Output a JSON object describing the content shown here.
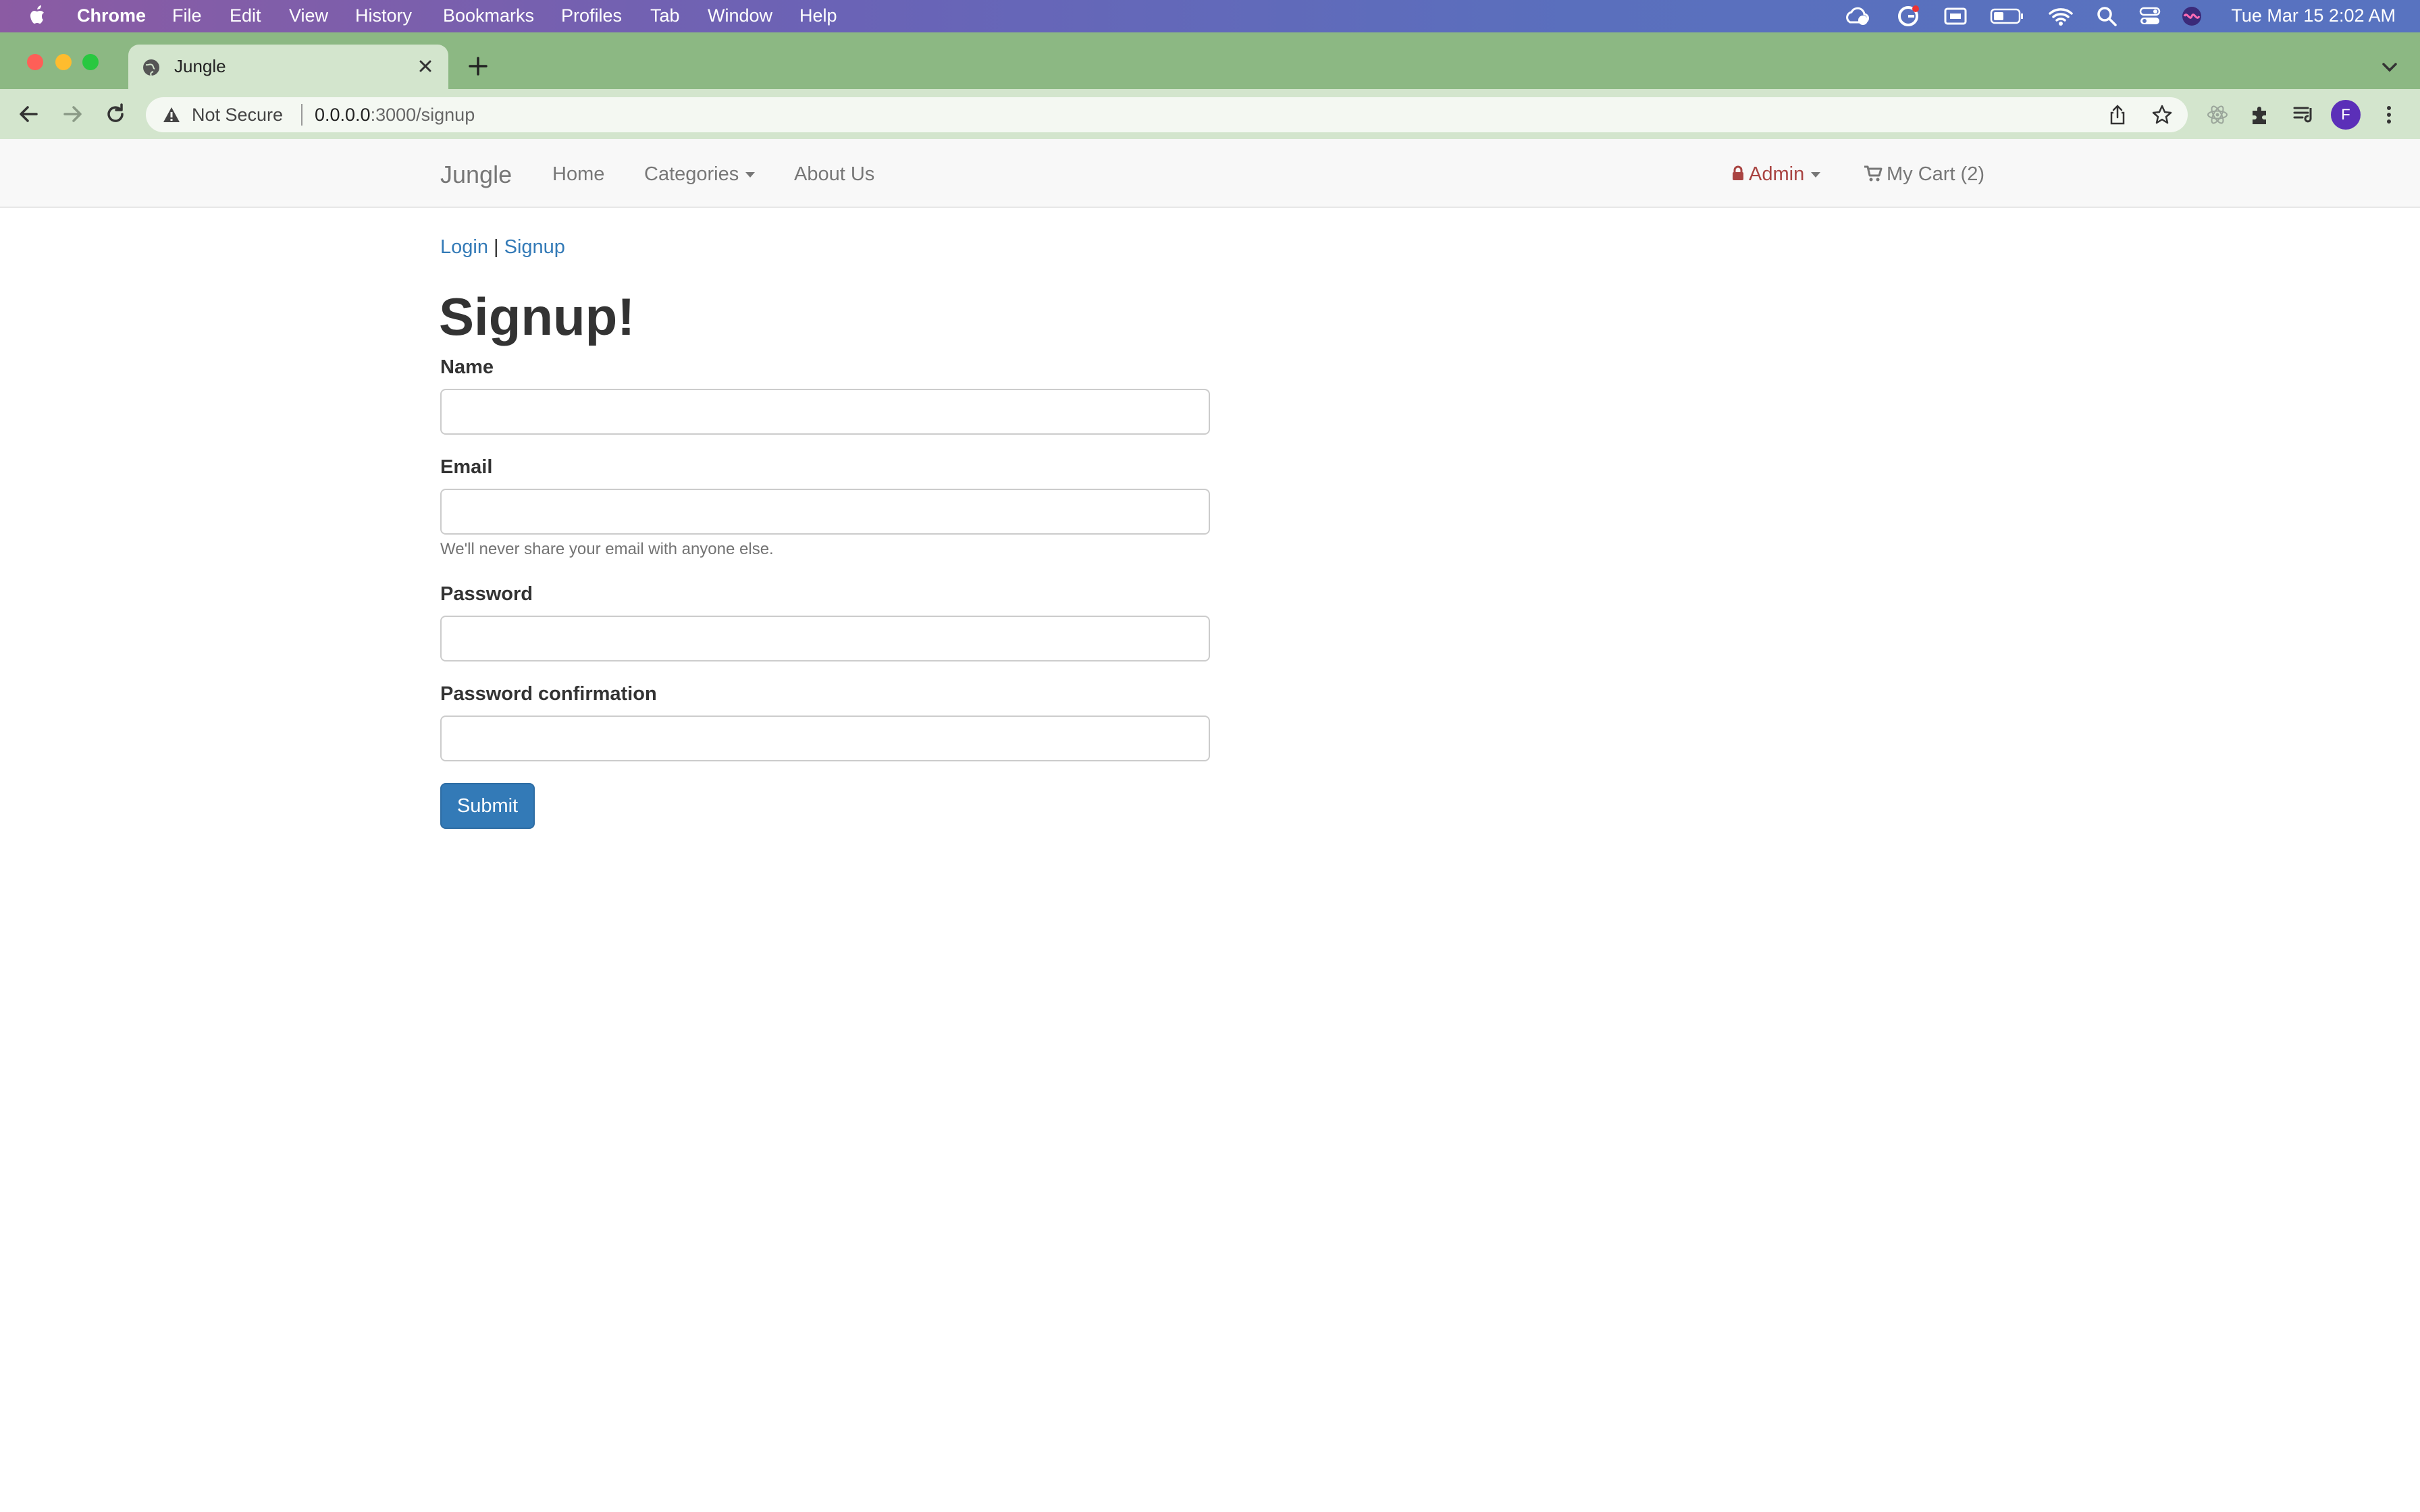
{
  "menubar": {
    "app": "Chrome",
    "items": [
      "File",
      "Edit",
      "View",
      "History",
      "Bookmarks",
      "Profiles",
      "Tab",
      "Window",
      "Help"
    ],
    "clock": "Tue Mar 15  2:02 AM",
    "status_icons": [
      "creative-cloud-icon",
      "grammarly-icon",
      "screen-mirroring-icon",
      "battery-icon",
      "wifi-icon",
      "spotlight-search-icon",
      "control-center-icon",
      "siri-icon"
    ]
  },
  "browser": {
    "tab_title": "Jungle",
    "omnibox": {
      "security_label": "Not Secure",
      "host": "0.0.0.0",
      "path": ":3000/signup"
    },
    "profile_initial": "F"
  },
  "site": {
    "brand": "Jungle",
    "nav": {
      "home": "Home",
      "categories": "Categories",
      "about": "About Us",
      "admin": "Admin",
      "cart": "My Cart (2)"
    }
  },
  "auth_links": {
    "login": "Login",
    "separator": "|",
    "signup": "Signup"
  },
  "form": {
    "heading": "Signup!",
    "name_label": "Name",
    "name_value": "",
    "email_label": "Email",
    "email_value": "",
    "email_help": "We'll never share your email with anyone else.",
    "password_label": "Password",
    "password_value": "",
    "password_confirmation_label": "Password confirmation",
    "password_confirmation_value": "",
    "submit_label": "Submit"
  },
  "colors": {
    "link": "#337ab7",
    "primary_button": "#337ab7",
    "admin": "#a94442",
    "tabstrip": "#8cb883",
    "toolbar": "#d3e5cd"
  }
}
